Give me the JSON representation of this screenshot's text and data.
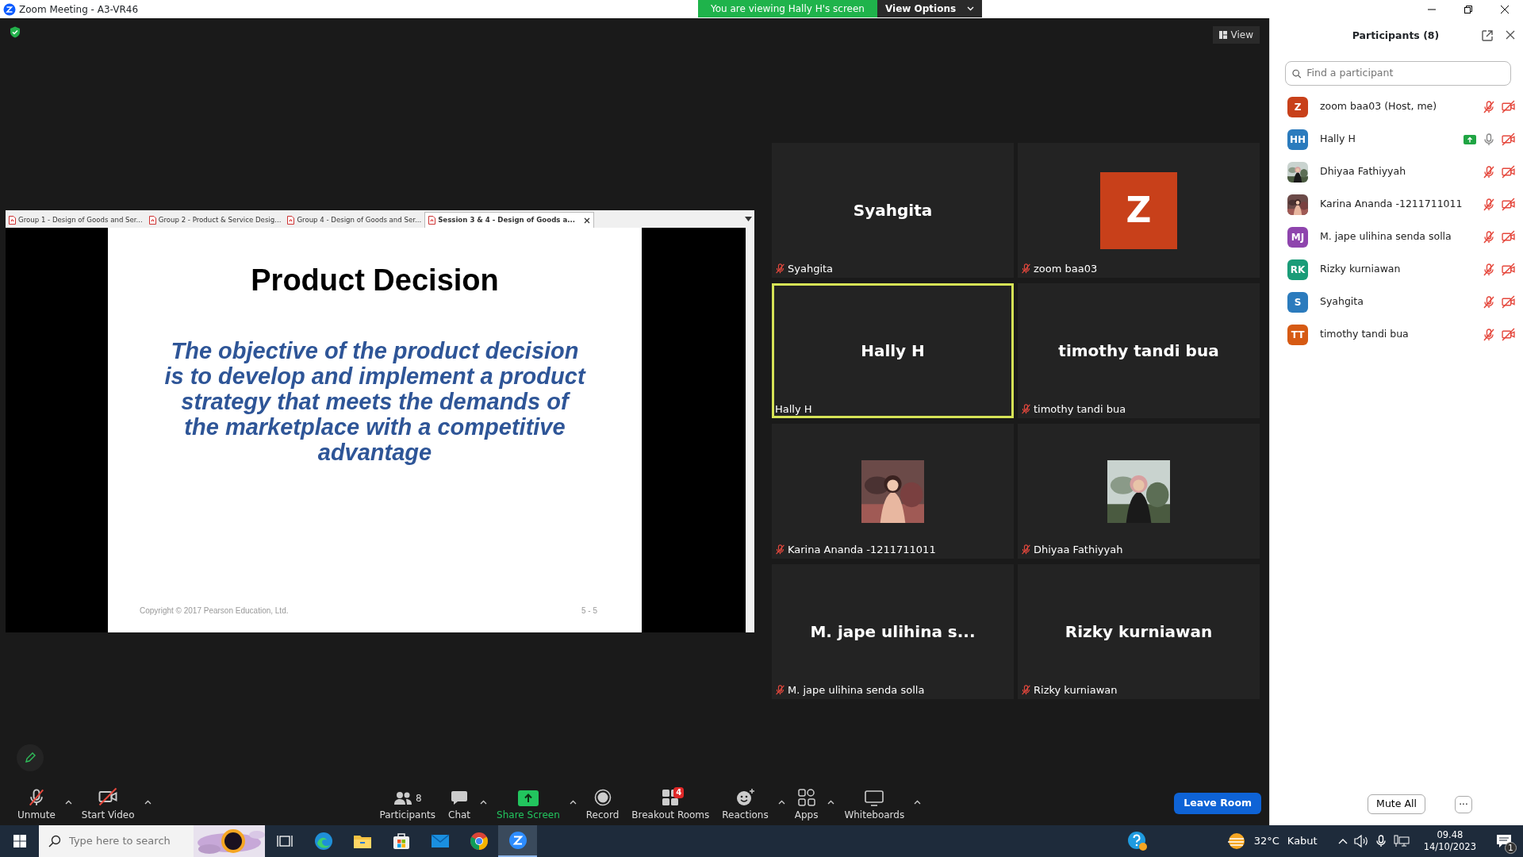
{
  "window": {
    "title": "Zoom Meeting - A3-VR46"
  },
  "banner": {
    "text": "You are viewing Hally H's screen",
    "menu": "View Options"
  },
  "view_button": "View",
  "shared_screen": {
    "tabs": [
      {
        "label": "Group 1 - Design of Goods and Ser...",
        "selected": false
      },
      {
        "label": "Group 2 - Product & Service Desig...",
        "selected": false
      },
      {
        "label": "Group 4 - Design of Goods and Ser...",
        "selected": false
      },
      {
        "label": "Session 3 & 4 - Design of Goods a...",
        "selected": true
      }
    ],
    "slide": {
      "title": "Product Decision",
      "body": "The objective of the product decision is to develop and implement a product strategy that meets the demands of the marketplace with a competitive advantage",
      "footer": "Copyright © 2017 Pearson Education, Ltd.",
      "page": "5 - 5"
    }
  },
  "video_tiles": [
    {
      "kind": "name",
      "display": "Syahgita",
      "name": "Syahgita",
      "muted": true,
      "active": false
    },
    {
      "kind": "avatar",
      "display": "Z",
      "color": "#c8401a",
      "name": "zoom baa03",
      "muted": true,
      "active": false
    },
    {
      "kind": "name",
      "display": "Hally H",
      "name": "Hally H",
      "muted": false,
      "active": true
    },
    {
      "kind": "name",
      "display": "timothy tandi bua",
      "name": "timothy tandi bua",
      "muted": true,
      "active": false
    },
    {
      "kind": "picture",
      "name": "Karina Ananda -1211711011",
      "muted": true,
      "active": false
    },
    {
      "kind": "picture",
      "name": "Dhiyaa Fathiyyah",
      "muted": true,
      "active": false
    },
    {
      "kind": "name",
      "display": "M. jape ulihina s...",
      "name": "M. jape ulihina senda solla",
      "muted": true,
      "active": false
    },
    {
      "kind": "name",
      "display": "Rizky kurniawan",
      "name": "Rizky kurniawan",
      "muted": true,
      "active": false
    }
  ],
  "participants_panel": {
    "title": "Participants (8)",
    "search": {
      "placeholder": "Find a participant"
    },
    "participants": [
      {
        "kind": "initials",
        "initials": "Z",
        "color": "#c8401a",
        "name": "zoom baa03 (Host, me)",
        "sharing": false,
        "mic_muted": true,
        "video_off": true
      },
      {
        "kind": "initials",
        "initials": "HH",
        "color": "#2b7bbd",
        "name": "Hally H",
        "sharing": true,
        "mic_muted": false,
        "video_off": true
      },
      {
        "kind": "picture",
        "name": "Dhiyaa Fathiyyah",
        "sharing": false,
        "mic_muted": true,
        "video_off": true
      },
      {
        "kind": "picture",
        "name": "Karina Ananda -1211711011",
        "sharing": false,
        "mic_muted": true,
        "video_off": true
      },
      {
        "kind": "initials",
        "initials": "MJ",
        "color": "#8e44ad",
        "name": "M. jape ulihina senda solla",
        "sharing": false,
        "mic_muted": true,
        "video_off": true
      },
      {
        "kind": "initials",
        "initials": "RK",
        "color": "#1a9c78",
        "name": "Rizky kurniawan",
        "sharing": false,
        "mic_muted": true,
        "video_off": true
      },
      {
        "kind": "initials",
        "initials": "S",
        "color": "#2b7bbd",
        "name": "Syahgita",
        "sharing": false,
        "mic_muted": true,
        "video_off": true
      },
      {
        "kind": "initials",
        "initials": "TT",
        "color": "#d65a13",
        "name": "timothy tandi bua",
        "sharing": false,
        "mic_muted": true,
        "video_off": true
      }
    ],
    "mute_all": "Mute All",
    "more": "···"
  },
  "toolbar": {
    "left": [
      {
        "kind": "mic",
        "label": "Unmute",
        "caret": true
      },
      {
        "kind": "video",
        "label": "Start Video",
        "caret": true
      }
    ],
    "center": [
      {
        "kind": "participants",
        "label": "Participants",
        "count": "8",
        "caret": false
      },
      {
        "kind": "chat",
        "label": "Chat",
        "caret": true
      },
      {
        "kind": "share",
        "label": "Share Screen",
        "caret": true
      },
      {
        "kind": "record",
        "label": "Record",
        "caret": false
      },
      {
        "kind": "breakout",
        "label": "Breakout Rooms",
        "badge": "4",
        "caret": false
      },
      {
        "kind": "reactions",
        "label": "Reactions",
        "caret": true
      },
      {
        "kind": "apps",
        "label": "Apps",
        "caret": true
      },
      {
        "kind": "whiteboard",
        "label": "Whiteboards",
        "caret": true
      }
    ],
    "leave": "Leave Room"
  },
  "taskbar": {
    "search": {
      "placeholder": "Type here to search"
    },
    "apps": [
      {
        "kind": "taskview",
        "active": false
      },
      {
        "kind": "edge",
        "active": false
      },
      {
        "kind": "explorer",
        "active": false
      },
      {
        "kind": "store",
        "active": false
      },
      {
        "kind": "mail",
        "active": false
      },
      {
        "kind": "chrome",
        "active": false
      },
      {
        "kind": "zoom",
        "active": true
      }
    ],
    "temperature": "32°C",
    "weather": "Kabut",
    "time": "09.48",
    "date": "14/10/2023",
    "notifications": "1"
  }
}
